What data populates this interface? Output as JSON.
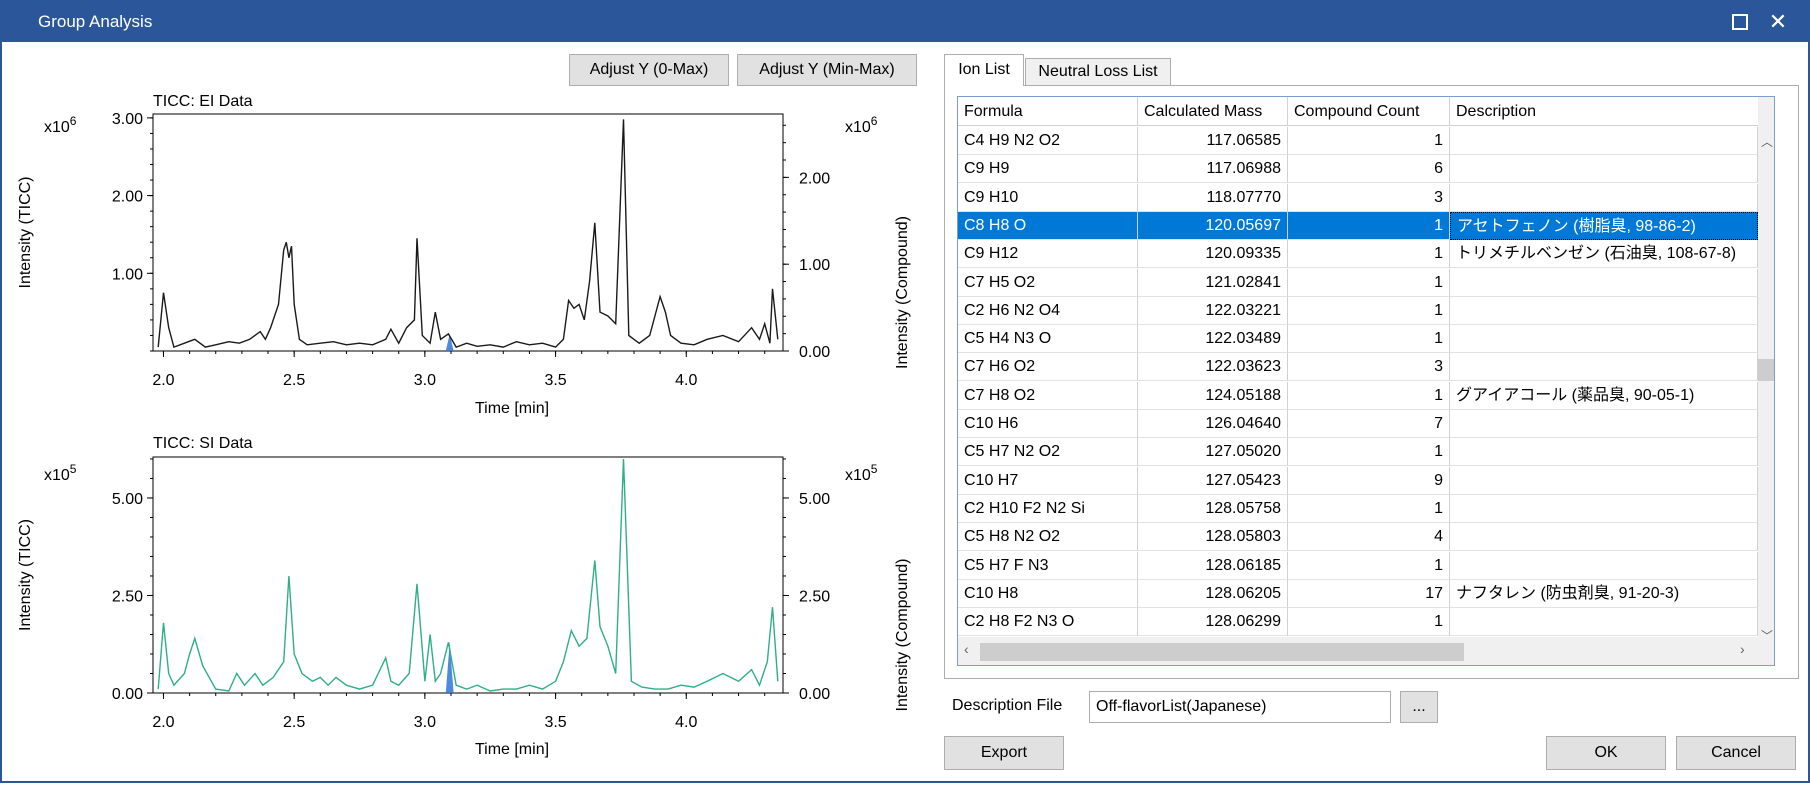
{
  "window": {
    "title": "Group Analysis",
    "maximize_icon": "maximize-icon",
    "close_icon": "close-icon"
  },
  "toolbar": {
    "adjust_y_0max": "Adjust Y (0-Max)",
    "adjust_y_minmax": "Adjust Y (Min-Max)"
  },
  "chart_data": [
    {
      "type": "line",
      "title": "TICC: EI Data",
      "xlabel": "Time [min]",
      "ylabel": "Intensity (TICC)",
      "ylabel_right": "Intensity (Compound)",
      "multiplier_left": "x10",
      "multiplier_right": "x10",
      "exponent": "6",
      "x_ticks": [
        "2.0",
        "2.5",
        "3.0",
        "3.5",
        "4.0"
      ],
      "y_ticks_left": [
        "1.00",
        "2.00",
        "3.00"
      ],
      "y_ticks_right": [
        "0.00",
        "1.00",
        "2.00"
      ],
      "xlim": [
        1.96,
        4.37
      ],
      "ylim": [
        0,
        3.05
      ],
      "ylim_right": [
        0,
        2.73
      ],
      "color": "#1a1a1a",
      "highlight_color": "#2f75d6",
      "highlight_range": [
        3.08,
        3.11
      ],
      "x": [
        1.98,
        2.0,
        2.02,
        2.04,
        2.08,
        2.12,
        2.16,
        2.2,
        2.25,
        2.29,
        2.33,
        2.37,
        2.39,
        2.41,
        2.44,
        2.46,
        2.47,
        2.48,
        2.49,
        2.5,
        2.52,
        2.55,
        2.6,
        2.65,
        2.7,
        2.75,
        2.8,
        2.85,
        2.87,
        2.9,
        2.93,
        2.96,
        2.97,
        2.99,
        3.02,
        3.04,
        3.06,
        3.09,
        3.12,
        3.16,
        3.2,
        3.25,
        3.3,
        3.35,
        3.4,
        3.45,
        3.5,
        3.53,
        3.55,
        3.57,
        3.59,
        3.61,
        3.63,
        3.65,
        3.67,
        3.7,
        3.73,
        3.76,
        3.78,
        3.82,
        3.86,
        3.9,
        3.92,
        3.94,
        3.98,
        4.03,
        4.08,
        4.14,
        4.2,
        4.25,
        4.28,
        4.3,
        4.32,
        4.33,
        4.35
      ],
      "y": [
        0.05,
        0.75,
        0.3,
        0.05,
        0.1,
        0.15,
        0.05,
        0.08,
        0.12,
        0.1,
        0.15,
        0.25,
        0.15,
        0.3,
        0.6,
        1.3,
        1.4,
        1.2,
        1.35,
        0.6,
        0.15,
        0.08,
        0.1,
        0.12,
        0.08,
        0.1,
        0.08,
        0.15,
        0.28,
        0.1,
        0.3,
        0.4,
        1.45,
        0.2,
        0.1,
        0.5,
        0.15,
        0.22,
        0.05,
        0.1,
        0.06,
        0.08,
        0.05,
        0.12,
        0.08,
        0.1,
        0.05,
        0.15,
        0.65,
        0.55,
        0.6,
        0.4,
        0.9,
        1.65,
        0.5,
        0.45,
        0.35,
        2.98,
        0.2,
        0.1,
        0.2,
        0.7,
        0.5,
        0.2,
        0.1,
        0.08,
        0.15,
        0.2,
        0.12,
        0.3,
        0.15,
        0.35,
        0.1,
        0.8,
        0.15
      ]
    },
    {
      "type": "line",
      "title": "TICC: SI Data",
      "xlabel": "Time [min]",
      "ylabel": "Intensity (TICC)",
      "ylabel_right": "Intensity (Compound)",
      "multiplier_left": "x10",
      "multiplier_right": "x10",
      "exponent": "5",
      "x_ticks": [
        "2.0",
        "2.5",
        "3.0",
        "3.5",
        "4.0"
      ],
      "y_ticks_left": [
        "0.00",
        "2.50",
        "5.00"
      ],
      "y_ticks_right": [
        "0.00",
        "2.50",
        "5.00"
      ],
      "xlim": [
        1.96,
        4.37
      ],
      "ylim": [
        0,
        6.05
      ],
      "ylim_right": [
        0,
        6.05
      ],
      "color": "#2eaf86",
      "highlight_color": "#2f75d6",
      "highlight_range": [
        3.08,
        3.11
      ],
      "x": [
        1.98,
        2.0,
        2.02,
        2.04,
        2.08,
        2.1,
        2.12,
        2.15,
        2.2,
        2.25,
        2.28,
        2.31,
        2.35,
        2.38,
        2.42,
        2.46,
        2.48,
        2.5,
        2.53,
        2.57,
        2.6,
        2.63,
        2.66,
        2.7,
        2.75,
        2.8,
        2.85,
        2.87,
        2.9,
        2.94,
        2.97,
        3.0,
        3.02,
        3.04,
        3.06,
        3.09,
        3.12,
        3.16,
        3.2,
        3.25,
        3.3,
        3.35,
        3.4,
        3.45,
        3.5,
        3.53,
        3.56,
        3.59,
        3.62,
        3.65,
        3.67,
        3.7,
        3.73,
        3.76,
        3.79,
        3.83,
        3.88,
        3.93,
        3.98,
        4.03,
        4.08,
        4.14,
        4.2,
        4.25,
        4.28,
        4.31,
        4.33,
        4.35
      ],
      "y": [
        0.1,
        1.8,
        0.5,
        0.2,
        0.5,
        1.0,
        1.4,
        0.7,
        0.1,
        0.05,
        0.5,
        0.2,
        0.5,
        0.2,
        0.4,
        0.8,
        3.0,
        1.0,
        0.5,
        0.3,
        0.4,
        0.2,
        0.4,
        0.2,
        0.1,
        0.2,
        0.9,
        0.3,
        0.2,
        0.5,
        2.8,
        0.3,
        1.5,
        0.3,
        0.5,
        1.3,
        0.2,
        0.1,
        0.2,
        0.05,
        0.1,
        0.1,
        0.2,
        0.1,
        0.3,
        0.8,
        1.6,
        1.2,
        1.4,
        3.4,
        1.7,
        1.2,
        0.5,
        6.0,
        0.3,
        0.15,
        0.1,
        0.1,
        0.2,
        0.15,
        0.3,
        0.5,
        0.3,
        0.6,
        0.2,
        0.8,
        2.2,
        0.3
      ]
    }
  ],
  "tabs": [
    {
      "label": "Ion List",
      "active": true
    },
    {
      "label": "Neutral Loss List",
      "active": false
    }
  ],
  "ion_table": {
    "columns": [
      "Formula",
      "Calculated Mass",
      "Compound Count",
      "Description"
    ],
    "rows": [
      {
        "formula": "C4 H9 N2 O2",
        "mass": "117.06585",
        "count": "1",
        "desc": ""
      },
      {
        "formula": "C9 H9",
        "mass": "117.06988",
        "count": "6",
        "desc": ""
      },
      {
        "formula": "C9 H10",
        "mass": "118.07770",
        "count": "3",
        "desc": ""
      },
      {
        "formula": "C8 H8 O",
        "mass": "120.05697",
        "count": "1",
        "desc": "アセトフェノン (樹脂臭, 98-86-2)",
        "selected": true
      },
      {
        "formula": "C9 H12",
        "mass": "120.09335",
        "count": "1",
        "desc": "トリメチルベンゼン (石油臭, 108-67-8)"
      },
      {
        "formula": "C7 H5 O2",
        "mass": "121.02841",
        "count": "1",
        "desc": ""
      },
      {
        "formula": "C2 H6 N2 O4",
        "mass": "122.03221",
        "count": "1",
        "desc": ""
      },
      {
        "formula": "C5 H4 N3 O",
        "mass": "122.03489",
        "count": "1",
        "desc": ""
      },
      {
        "formula": "C7 H6 O2",
        "mass": "122.03623",
        "count": "3",
        "desc": ""
      },
      {
        "formula": "C7 H8 O2",
        "mass": "124.05188",
        "count": "1",
        "desc": "グアイアコール (薬品臭, 90-05-1)"
      },
      {
        "formula": "C10 H6",
        "mass": "126.04640",
        "count": "7",
        "desc": ""
      },
      {
        "formula": "C5 H7 N2 O2",
        "mass": "127.05020",
        "count": "1",
        "desc": ""
      },
      {
        "formula": "C10 H7",
        "mass": "127.05423",
        "count": "9",
        "desc": ""
      },
      {
        "formula": "C2 H10 F2 N2 Si",
        "mass": "128.05758",
        "count": "1",
        "desc": ""
      },
      {
        "formula": "C5 H8 N2 O2",
        "mass": "128.05803",
        "count": "4",
        "desc": ""
      },
      {
        "formula": "C5 H7 F N3",
        "mass": "128.06185",
        "count": "1",
        "desc": ""
      },
      {
        "formula": "C10 H8",
        "mass": "128.06205",
        "count": "17",
        "desc": "ナフタレン (防虫剤臭, 91-20-3)"
      },
      {
        "formula": "C2 H8 F2 N3 O",
        "mass": "128.06299",
        "count": "1",
        "desc": ""
      }
    ]
  },
  "description_file": {
    "label": "Description File",
    "value": "Off-flavorList(Japanese)",
    "browse_label": "..."
  },
  "footer": {
    "export_label": "Export",
    "ok_label": "OK",
    "cancel_label": "Cancel"
  },
  "colors": {
    "titlebar": "#2b579a",
    "selection": "#0078d7",
    "ei_trace": "#1a1a1a",
    "si_trace": "#2eaf86",
    "highlight": "#2f75d6"
  }
}
